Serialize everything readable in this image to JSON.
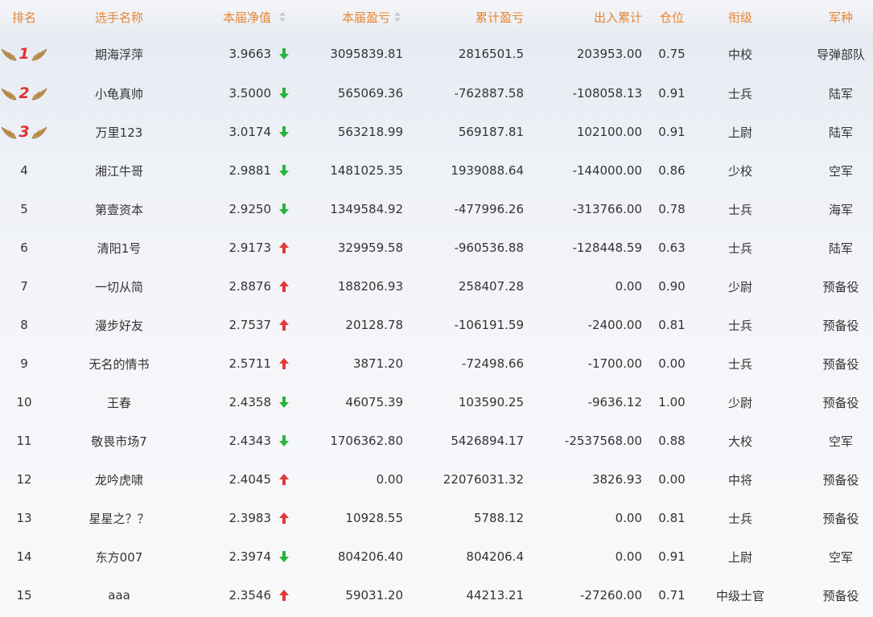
{
  "colors": {
    "header_text": "#e8852f",
    "up": "#e13a3a",
    "down": "#28b43c"
  },
  "header": {
    "rank": "排名",
    "name": "选手名称",
    "nav": "本届净值",
    "profit": "本届盈亏",
    "cum_profit": "累计盈亏",
    "io": "出入累计",
    "position": "仓位",
    "rank_title": "衔级",
    "branch": "军种"
  },
  "rows": [
    {
      "rank": "1",
      "name": "期海浮萍",
      "nav": "3.9663",
      "trend": "down",
      "profit": "3095839.81",
      "cum": "2816501.5",
      "io": "203953.00",
      "pos": "0.75",
      "title": "中校",
      "branch": "导弹部队"
    },
    {
      "rank": "2",
      "name": "小龟真帅",
      "nav": "3.5000",
      "trend": "down",
      "profit": "565069.36",
      "cum": "-762887.58",
      "io": "-108058.13",
      "pos": "0.91",
      "title": "士兵",
      "branch": "陆军"
    },
    {
      "rank": "3",
      "name": "万里123",
      "nav": "3.0174",
      "trend": "down",
      "profit": "563218.99",
      "cum": "569187.81",
      "io": "102100.00",
      "pos": "0.91",
      "title": "上尉",
      "branch": "陆军"
    },
    {
      "rank": "4",
      "name": "湘江牛哥",
      "nav": "2.9881",
      "trend": "down",
      "profit": "1481025.35",
      "cum": "1939088.64",
      "io": "-144000.00",
      "pos": "0.86",
      "title": "少校",
      "branch": "空军"
    },
    {
      "rank": "5",
      "name": "第壹资本",
      "nav": "2.9250",
      "trend": "down",
      "profit": "1349584.92",
      "cum": "-477996.26",
      "io": "-313766.00",
      "pos": "0.78",
      "title": "士兵",
      "branch": "海军"
    },
    {
      "rank": "6",
      "name": "清阳1号",
      "nav": "2.9173",
      "trend": "up",
      "profit": "329959.58",
      "cum": "-960536.88",
      "io": "-128448.59",
      "pos": "0.63",
      "title": "士兵",
      "branch": "陆军"
    },
    {
      "rank": "7",
      "name": "一切从简",
      "nav": "2.8876",
      "trend": "up",
      "profit": "188206.93",
      "cum": "258407.28",
      "io": "0.00",
      "pos": "0.90",
      "title": "少尉",
      "branch": "预备役"
    },
    {
      "rank": "8",
      "name": "漫步好友",
      "nav": "2.7537",
      "trend": "up",
      "profit": "20128.78",
      "cum": "-106191.59",
      "io": "-2400.00",
      "pos": "0.81",
      "title": "士兵",
      "branch": "预备役"
    },
    {
      "rank": "9",
      "name": "无名的情书",
      "nav": "2.5711",
      "trend": "up",
      "profit": "3871.20",
      "cum": "-72498.66",
      "io": "-1700.00",
      "pos": "0.00",
      "title": "士兵",
      "branch": "预备役"
    },
    {
      "rank": "10",
      "name": "王春",
      "nav": "2.4358",
      "trend": "down",
      "profit": "46075.39",
      "cum": "103590.25",
      "io": "-9636.12",
      "pos": "1.00",
      "title": "少尉",
      "branch": "预备役"
    },
    {
      "rank": "11",
      "name": "敬畏市场7",
      "nav": "2.4343",
      "trend": "down",
      "profit": "1706362.80",
      "cum": "5426894.17",
      "io": "-2537568.00",
      "pos": "0.88",
      "title": "大校",
      "branch": "空军"
    },
    {
      "rank": "12",
      "name": "龙吟虎啸",
      "nav": "2.4045",
      "trend": "up",
      "profit": "0.00",
      "cum": "22076031.32",
      "io": "3826.93",
      "pos": "0.00",
      "title": "中将",
      "branch": "预备役"
    },
    {
      "rank": "13",
      "name": "星星之？？",
      "nav": "2.3983",
      "trend": "up",
      "profit": "10928.55",
      "cum": "5788.12",
      "io": "0.00",
      "pos": "0.81",
      "title": "士兵",
      "branch": "预备役"
    },
    {
      "rank": "14",
      "name": "东方007",
      "nav": "2.3974",
      "trend": "down",
      "profit": "804206.40",
      "cum": "804206.4",
      "io": "0.00",
      "pos": "0.91",
      "title": "上尉",
      "branch": "空军"
    },
    {
      "rank": "15",
      "name": "aaa",
      "nav": "2.3546",
      "trend": "up",
      "profit": "59031.20",
      "cum": "44213.21",
      "io": "-27260.00",
      "pos": "0.71",
      "title": "中级士官",
      "branch": "预备役"
    }
  ]
}
